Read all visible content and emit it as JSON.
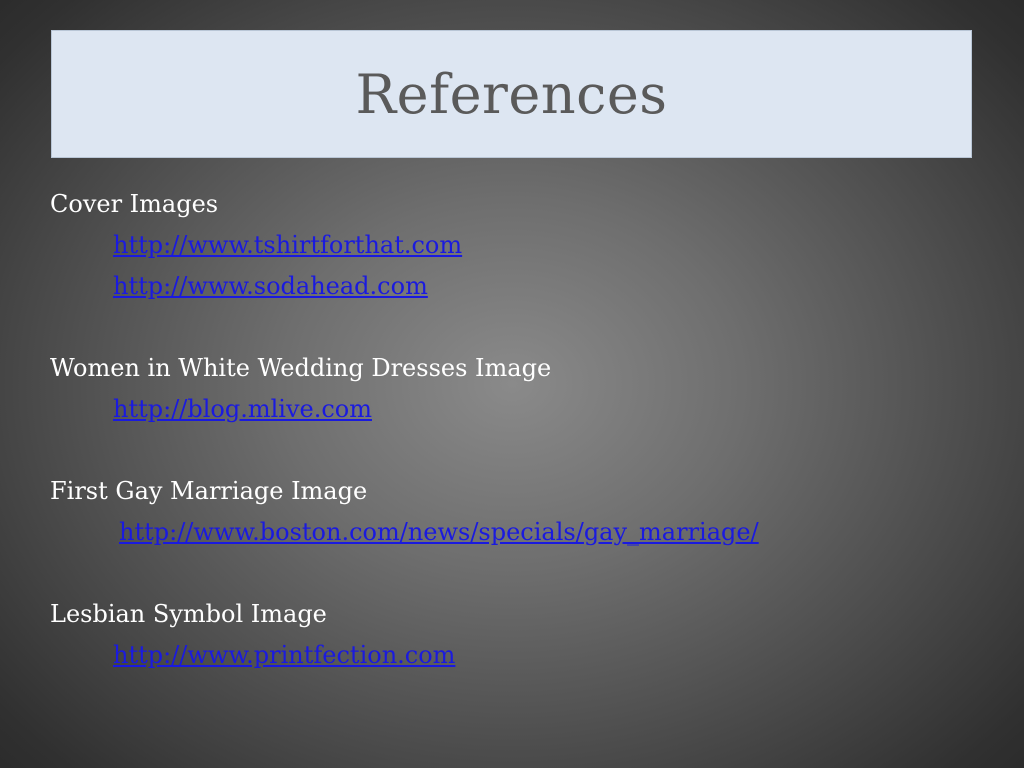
{
  "slide": {
    "title": "References",
    "sections": [
      {
        "heading": "Cover Images",
        "links": [
          "http://www.tshirtforthat.com",
          "http://www.sodahead.com"
        ]
      },
      {
        "heading": "Women in White Wedding Dresses Image",
        "links": [
          "http://blog.mlive.com"
        ]
      },
      {
        "heading": "First Gay Marriage Image",
        "links": [
          "http://www.boston.com/news/specials/gay_marriage/"
        ]
      },
      {
        "heading": "Lesbian Symbol Image",
        "links": [
          "http://www.printfection.com"
        ]
      }
    ]
  },
  "colors": {
    "title_box": "#dde6f2",
    "title_text": "#5a5a5a",
    "body_text": "#ffffff",
    "link": "#1a1adf"
  }
}
